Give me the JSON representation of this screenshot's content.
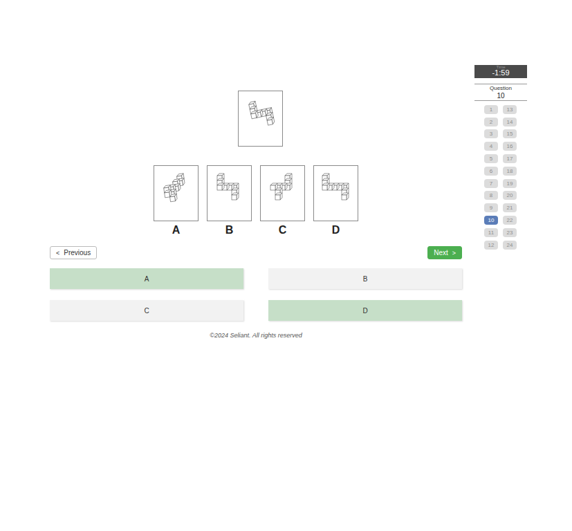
{
  "timer": {
    "label": "Time",
    "value": "-1:59"
  },
  "question_panel": {
    "label": "Question",
    "number": "10"
  },
  "question_nav": [
    {
      "number": "1",
      "selected": false
    },
    {
      "number": "2",
      "selected": false
    },
    {
      "number": "3",
      "selected": false
    },
    {
      "number": "4",
      "selected": false
    },
    {
      "number": "5",
      "selected": false
    },
    {
      "number": "6",
      "selected": false
    },
    {
      "number": "7",
      "selected": false
    },
    {
      "number": "8",
      "selected": false
    },
    {
      "number": "9",
      "selected": false
    },
    {
      "number": "10",
      "selected": true
    },
    {
      "number": "11",
      "selected": false
    },
    {
      "number": "12",
      "selected": false
    },
    {
      "number": "13",
      "selected": false
    },
    {
      "number": "14",
      "selected": false
    },
    {
      "number": "15",
      "selected": false
    },
    {
      "number": "16",
      "selected": false
    },
    {
      "number": "17",
      "selected": false
    },
    {
      "number": "18",
      "selected": false
    },
    {
      "number": "19",
      "selected": false
    },
    {
      "number": "20",
      "selected": false
    },
    {
      "number": "21",
      "selected": false
    },
    {
      "number": "22",
      "selected": false
    },
    {
      "number": "23",
      "selected": false
    },
    {
      "number": "24",
      "selected": false
    }
  ],
  "figure_options": [
    {
      "label": "A"
    },
    {
      "label": "B"
    },
    {
      "label": "C"
    },
    {
      "label": "D"
    }
  ],
  "nav": {
    "previous_icon": "<",
    "previous": "Previous",
    "next": "Next",
    "next_icon": ">"
  },
  "answers": [
    {
      "label": "A",
      "selected": true
    },
    {
      "label": "B",
      "selected": false
    },
    {
      "label": "C",
      "selected": false
    },
    {
      "label": "D",
      "selected": true
    }
  ],
  "footer": "©2024 Seliant. All rights reserved"
}
